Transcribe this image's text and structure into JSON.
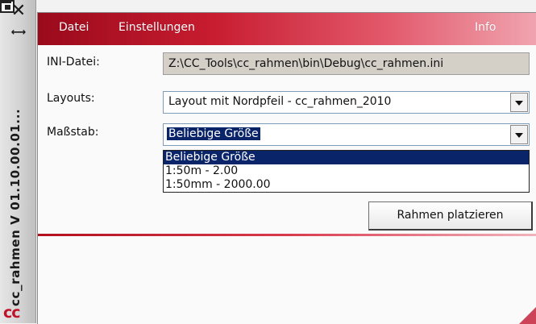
{
  "window": {
    "title": "cc_rahmen V 01.10.00.01...",
    "logo_text": "cc",
    "close_glyph": "✕",
    "pin_glyph": "⟷"
  },
  "menu": {
    "items": [
      "Datei",
      "Einstellungen"
    ],
    "info": "Info"
  },
  "form": {
    "ini_label": "INI-Datei:",
    "ini_value": "Z:\\CC_Tools\\cc_rahmen\\bin\\Debug\\cc_rahmen.ini",
    "layouts_label": "Layouts:",
    "layouts_value": "Layout mit Nordpfeil  -  cc_rahmen_2010",
    "scale_label": "Maßstab:",
    "scale_value": "Beliebige Größe",
    "scale_options": [
      "Beliebige Größe",
      "1:50m - 2.00",
      "1:50mm - 2000.00"
    ],
    "scale_selected_index": 0
  },
  "actions": {
    "place_button": "Rahmen platzieren"
  },
  "colors": {
    "accent": "#c81c30",
    "selection": "#0a246a"
  }
}
